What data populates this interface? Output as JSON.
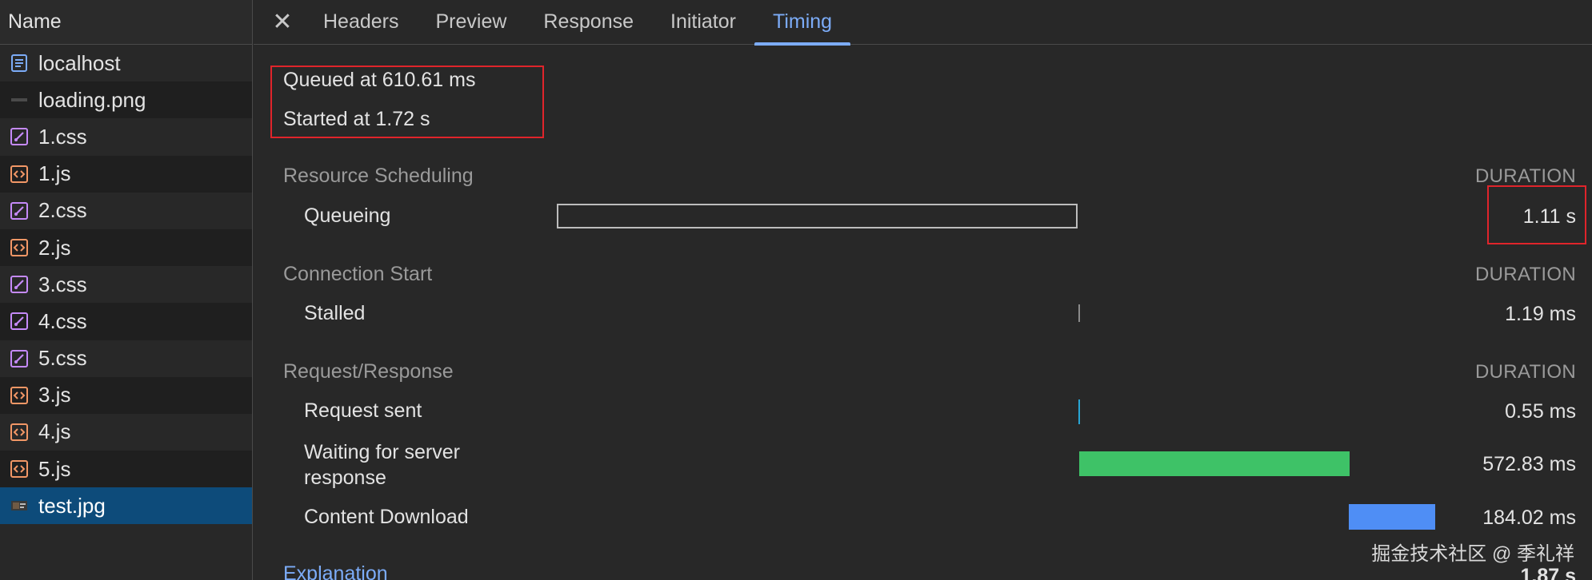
{
  "sidebar": {
    "header": "Name",
    "items": [
      {
        "label": "localhost",
        "icon": "document-icon"
      },
      {
        "label": "loading.png",
        "icon": "image-icon"
      },
      {
        "label": "1.css",
        "icon": "css-icon"
      },
      {
        "label": "1.js",
        "icon": "js-icon"
      },
      {
        "label": "2.css",
        "icon": "css-icon"
      },
      {
        "label": "2.js",
        "icon": "js-icon"
      },
      {
        "label": "3.css",
        "icon": "css-icon"
      },
      {
        "label": "4.css",
        "icon": "css-icon"
      },
      {
        "label": "5.css",
        "icon": "css-icon"
      },
      {
        "label": "3.js",
        "icon": "js-icon"
      },
      {
        "label": "4.js",
        "icon": "js-icon"
      },
      {
        "label": "5.js",
        "icon": "js-icon"
      },
      {
        "label": "test.jpg",
        "icon": "image-icon",
        "selected": true
      }
    ]
  },
  "tabs": {
    "close_symbol": "✕",
    "items": [
      "Headers",
      "Preview",
      "Response",
      "Initiator",
      "Timing"
    ],
    "active": "Timing"
  },
  "timing": {
    "queued_at": "Queued at 610.61 ms",
    "started_at": "Started at 1.72 s",
    "duration_header": "DURATION",
    "sections": {
      "resource_scheduling": {
        "title": "Resource Scheduling",
        "rows": [
          {
            "label": "Queueing",
            "value": "1.11 s"
          }
        ]
      },
      "connection_start": {
        "title": "Connection Start",
        "rows": [
          {
            "label": "Stalled",
            "value": "1.19 ms"
          }
        ]
      },
      "request_response": {
        "title": "Request/Response",
        "rows": [
          {
            "label": "Request sent",
            "value": "0.55 ms"
          },
          {
            "label": "Waiting for server response",
            "value": "572.83 ms"
          },
          {
            "label": "Content Download",
            "value": "184.02 ms"
          }
        ]
      }
    },
    "explanation": "Explanation",
    "total": "1.87 s"
  },
  "watermark": "掘金技术社区 @ 季礼祥",
  "colors": {
    "accent": "#7cacf8",
    "selected_row": "#0d4b7a",
    "waiting_bar": "#3ec267",
    "download_bar": "#4f8ef5",
    "request_bar": "#28a5d4",
    "annotation_red": "#e0242b"
  }
}
